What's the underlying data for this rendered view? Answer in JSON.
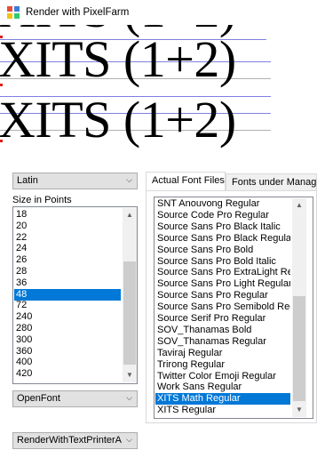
{
  "window": {
    "title": "Render with PixelFarm"
  },
  "preview": {
    "text": "XITS (1+2)"
  },
  "script_select": {
    "value": "Latin"
  },
  "size_label": "Size in Points",
  "sizes": [
    "18",
    "20",
    "22",
    "24",
    "26",
    "28",
    "36",
    "48",
    "72",
    "240",
    "280",
    "300",
    "360",
    "400",
    "420"
  ],
  "selected_size": "48",
  "engine_select": {
    "value": "OpenFont"
  },
  "renderer_select": {
    "value": "RenderWithTextPrinterAr"
  },
  "tabs": [
    "Actual Font Files",
    "Fonts under Manag"
  ],
  "fonts": [
    "SNT Anouvong Regular",
    "Source Code Pro Regular",
    "Source Sans Pro Black Italic",
    "Source Sans Pro Black Regular",
    "Source Sans Pro Bold",
    "Source Sans Pro Bold Italic",
    "Source Sans Pro ExtraLight Reg",
    "Source Sans Pro Light Regular",
    "Source Sans Pro Regular",
    "Source Sans Pro Semibold Reg",
    "Source Serif Pro Regular",
    "SOV_Thanamas Bold",
    "SOV_Thanamas Regular",
    "Taviraj Regular",
    "Trirong Regular",
    "Twitter Color Emoji Regular",
    "Work Sans Regular",
    "XITS Math Regular",
    "XITS Regular"
  ],
  "selected_font": "XITS Math Regular"
}
